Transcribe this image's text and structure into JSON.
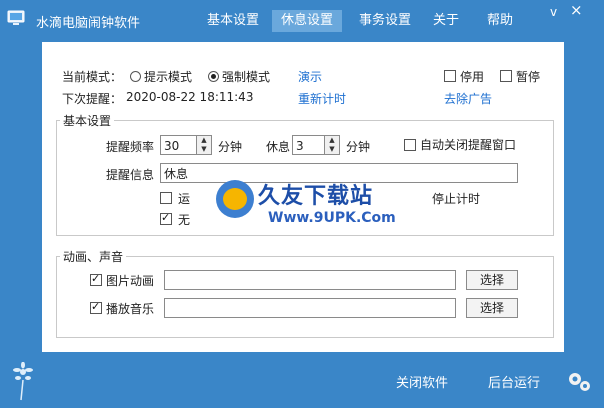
{
  "app": {
    "title": "水滴电脑闹钟软件"
  },
  "tabs": [
    "基本设置",
    "休息设置",
    "事务设置",
    "关于",
    "帮助"
  ],
  "window_controls": {
    "minimize": "v",
    "close": "×"
  },
  "mode": {
    "label": "当前模式：",
    "option1": "提示模式",
    "option2": "强制模式",
    "selected": "强制模式",
    "demo_link": "演示",
    "disable": "停用",
    "pause": "暂停"
  },
  "next": {
    "label": "下次提醒：",
    "value": "2020-08-22 18:11:43",
    "retime_link": "重新计时",
    "remove_ad_link": "去除广告"
  },
  "basic": {
    "title": "基本设置",
    "freq_label": "提醒频率",
    "freq_value": "30",
    "freq_unit": "分钟",
    "rest_label": "休息",
    "rest_value": "3",
    "rest_unit": "分钟",
    "autoclose": "自动关闭提醒窗口",
    "info_label": "提醒信息",
    "info_value": "休息",
    "row3_left": "运",
    "row3_right": "停止计时",
    "row4_left": "无"
  },
  "anim": {
    "title": "动画、声音",
    "pic_label": "图片动画",
    "pic_value": "",
    "music_label": "播放音乐",
    "music_value": "",
    "choose": "选择"
  },
  "bottom": {
    "close_btn": "关闭软件",
    "bg_run_btn": "后台运行"
  },
  "watermark": {
    "brand": "久友下载站",
    "url": "Www.9UPK.Com"
  }
}
